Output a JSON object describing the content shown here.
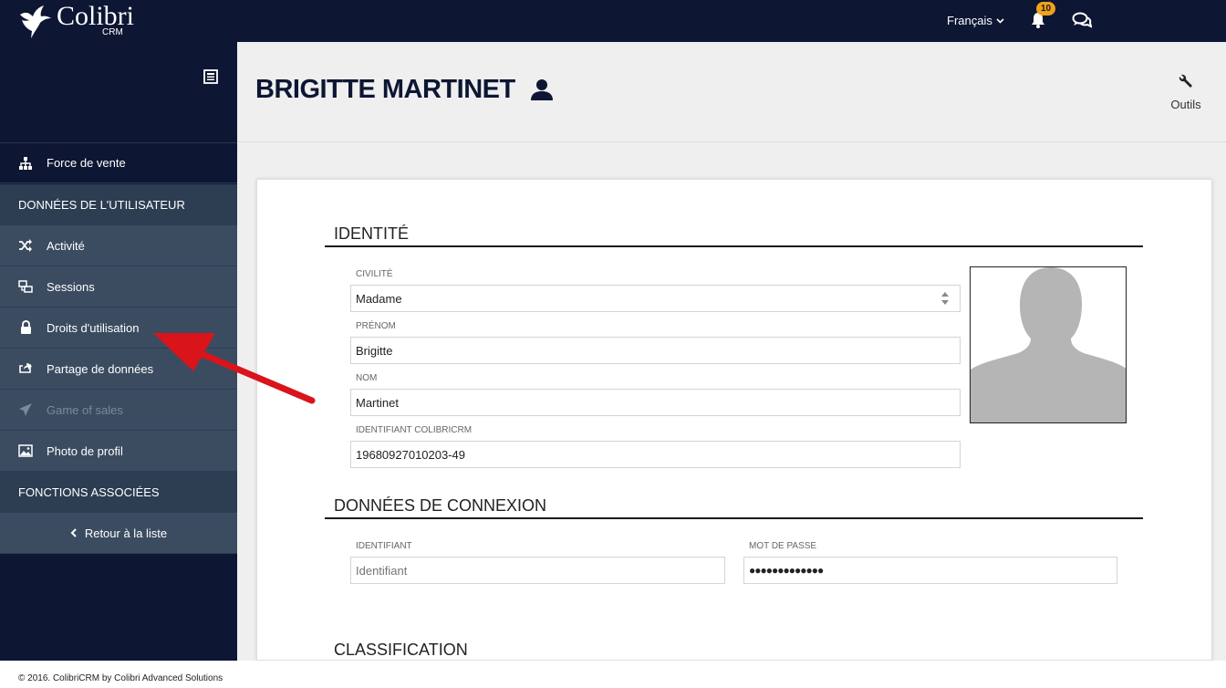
{
  "app": {
    "logo_text": "Colibri",
    "logo_sub": "CRM"
  },
  "topbar": {
    "language": "Français",
    "notifications_count": "10"
  },
  "sidebar": {
    "items": [
      {
        "label": "Force de vente",
        "icon": "sitemap-icon"
      },
      {
        "label": "DONNÉES DE L'UTILISATEUR",
        "type": "header"
      },
      {
        "label": "Activité",
        "icon": "shuffle-icon"
      },
      {
        "label": "Sessions",
        "icon": "sessions-icon"
      },
      {
        "label": "Droits d'utilisation",
        "icon": "lock-icon"
      },
      {
        "label": "Partage de données",
        "icon": "share-icon"
      },
      {
        "label": "Game of sales",
        "icon": "paper-plane-icon",
        "disabled": true
      },
      {
        "label": "Photo de profil",
        "icon": "image-icon"
      },
      {
        "label": "FONCTIONS ASSOCIÉES",
        "type": "header"
      },
      {
        "label": "Retour à la liste",
        "icon": "chevron-left-icon"
      }
    ]
  },
  "header": {
    "title": "BRIGITTE MARTINET",
    "tools_label": "Outils"
  },
  "identity": {
    "section_title": "IDENTITÉ",
    "civilite_label": "CIVILITÉ",
    "civilite_value": "Madame",
    "prenom_label": "PRÉNOM",
    "prenom_value": "Brigitte",
    "nom_label": "NOM",
    "nom_value": "Martinet",
    "id_label": "IDENTIFIANT COLIBRICRM",
    "id_value": "19680927010203-49"
  },
  "connexion": {
    "section_title": "DONNÉES DE CONNEXION",
    "login_label": "IDENTIFIANT",
    "login_placeholder": "Identifiant",
    "password_label": "MOT DE PASSE",
    "password_value": "●●●●●●●●●●●●●"
  },
  "classification": {
    "section_title": "CLASSIFICATION"
  },
  "footer": {
    "text": "© 2016. ColibriCRM by Colibri Advanced Solutions"
  },
  "colors": {
    "navy": "#0d1633",
    "sidebar_item": "#3b4c60",
    "sidebar_header": "#2d3d52",
    "badge": "#f0a21c",
    "annotation_arrow": "#d9141a"
  }
}
